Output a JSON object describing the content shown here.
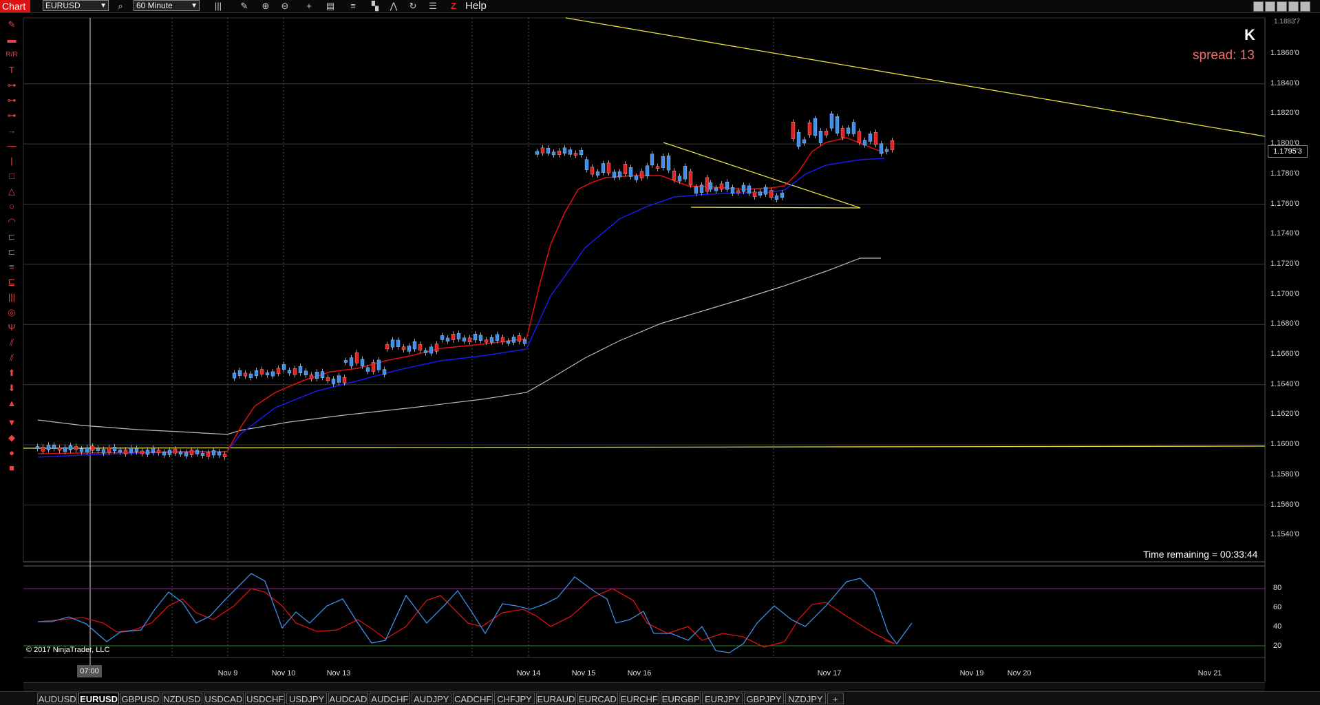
{
  "toolbar": {
    "app_label": "Chart",
    "instrument": "EURUSD",
    "timeframe": "60 Minute",
    "help_label": "Help"
  },
  "chart": {
    "spread_text": "spread: 13",
    "time_remaining": "Time remaining = 00:33:44",
    "copyright": "© 2017 NinjaTrader, LLC",
    "current_price": "1.1795'3",
    "top_price_tag": "1.1883'7",
    "cursor_time_label": "07:00",
    "price_axis": [
      "1.1860'0",
      "1.1840'0",
      "1.1820'0",
      "1.1800'0",
      "1.1780'0",
      "1.1760'0",
      "1.1740'0",
      "1.1720'0",
      "1.1700'0",
      "1.1680'0",
      "1.1660'0",
      "1.1640'0",
      "1.1620'0",
      "1.1600'0",
      "1.1580'0",
      "1.1560'0",
      "1.1540'0"
    ],
    "oscillator_axis": [
      "80",
      "60",
      "40",
      "20"
    ],
    "date_axis": [
      "Nov 9",
      "Nov 10",
      "Nov 13",
      "Nov 14",
      "Nov 15",
      "Nov 16",
      "Nov 17",
      "Nov 19",
      "Nov 20",
      "Nov 21"
    ],
    "colors": {
      "bull": "#3f8fe8",
      "bear": "#e22222",
      "fast_ma": "#e01010",
      "slow_ma": "#1a1aee",
      "long_ma": "#bbbbbb",
      "trendline": "#e8e040",
      "spread": "#f07070"
    }
  },
  "tabs": [
    "AUDUSD",
    "EURUSD",
    "GBPUSD",
    "NZDUSD",
    "USDCAD",
    "USDCHF",
    "USDJPY",
    "AUDCAD",
    "AUDCHF",
    "AUDJPY",
    "CADCHF",
    "CHFJPY",
    "EURAUD",
    "EURCAD",
    "EURCHF",
    "EURGBP",
    "EURJPY",
    "GBPJPY",
    "NZDJPY",
    "+"
  ],
  "active_tab": "EURUSD"
}
